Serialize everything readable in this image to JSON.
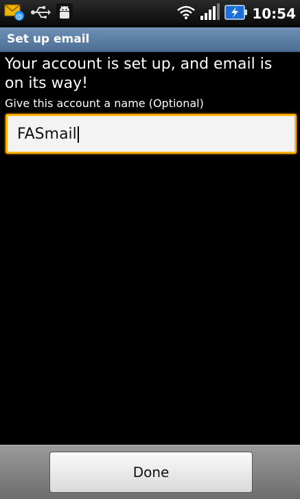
{
  "status_bar": {
    "time": "10:54",
    "icons": [
      "email-notification-icon",
      "usb-icon",
      "android-debug-icon",
      "wifi-icon",
      "signal-icon",
      "battery-charging-icon"
    ]
  },
  "title_bar": {
    "title": "Set up email"
  },
  "content": {
    "heading": "Your account is set up, and email is on its way!",
    "account_name_label": "Give this account a name (Optional)",
    "account_name_value": "FASmail"
  },
  "bottom_bar": {
    "done_label": "Done"
  },
  "colors": {
    "title_bar": "#5b7da6",
    "focus_border": "#ffb000",
    "background": "#000000"
  }
}
